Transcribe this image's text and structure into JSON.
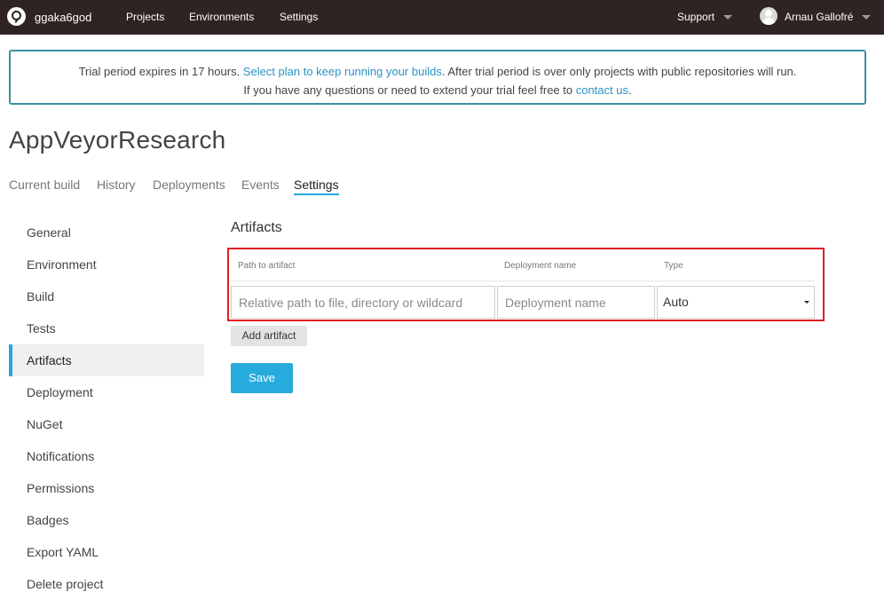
{
  "topbar": {
    "account": "ggaka6god",
    "nav": [
      "Projects",
      "Environments",
      "Settings"
    ],
    "support": "Support",
    "user": "Arnau Gallofré"
  },
  "banner": {
    "line1_prefix": "Trial period expires in 17 hours. ",
    "line1_link": "Select plan to keep running your builds",
    "line1_suffix": ". After trial period is over only projects with public repositories will run.",
    "line2_prefix": "If you have any questions or need to extend your trial feel free to ",
    "line2_link": "contact us",
    "line2_suffix": "."
  },
  "project": {
    "title": "AppVeyorResearch"
  },
  "tabs": [
    "Current build",
    "History",
    "Deployments",
    "Events",
    "Settings"
  ],
  "active_tab": "Settings",
  "sidebar": {
    "items": [
      "General",
      "Environment",
      "Build",
      "Tests",
      "Artifacts",
      "Deployment",
      "NuGet",
      "Notifications",
      "Permissions",
      "Badges",
      "Export YAML",
      "Delete project"
    ],
    "active": "Artifacts"
  },
  "artifacts": {
    "title": "Artifacts",
    "columns": {
      "path": "Path to artifact",
      "name": "Deployment name",
      "type": "Type"
    },
    "path_placeholder": "Relative path to file, directory or wildcard",
    "name_placeholder": "Deployment name",
    "type_value": "Auto",
    "add_label": "Add artifact",
    "save_label": "Save"
  },
  "colors": {
    "topbar": "#2f2422",
    "accent": "#27abdd",
    "banner_border": "#3b8ea5",
    "highlight": "#e31e24"
  }
}
